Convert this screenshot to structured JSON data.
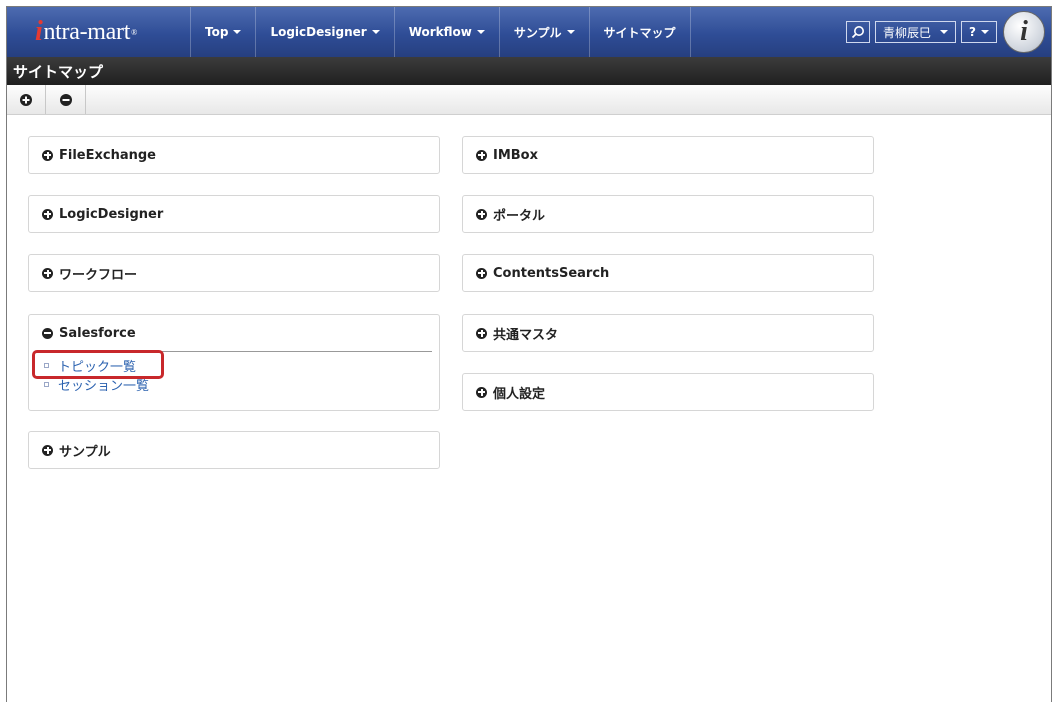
{
  "header": {
    "logo": {
      "mark": "i",
      "text": "ntra-mart",
      "reg": "®"
    },
    "nav": [
      {
        "label": "Top",
        "dropdown": true
      },
      {
        "label": "LogicDesigner",
        "dropdown": true
      },
      {
        "label": "Workflow",
        "dropdown": true
      },
      {
        "label": "サンプル",
        "dropdown": true
      },
      {
        "label": "サイトマップ",
        "dropdown": false
      }
    ],
    "user": {
      "name": "青柳辰巳"
    },
    "help_label": "?",
    "brand_glyph": "i"
  },
  "page": {
    "title": "サイトマップ"
  },
  "toolbar": {
    "expand_all_icon": "plus-circle-icon",
    "collapse_all_icon": "minus-circle-icon"
  },
  "sitemap": {
    "left": [
      {
        "label": "FileExchange",
        "expanded": false
      },
      {
        "label": "LogicDesigner",
        "expanded": false
      },
      {
        "label": "ワークフロー",
        "expanded": false
      },
      {
        "label": "Salesforce",
        "expanded": true,
        "items": [
          "トピック一覧",
          "セッション一覧"
        ]
      },
      {
        "label": "サンプル",
        "expanded": false
      }
    ],
    "right": [
      {
        "label": "IMBox",
        "expanded": false
      },
      {
        "label": "ポータル",
        "expanded": false
      },
      {
        "label": "ContentsSearch",
        "expanded": false
      },
      {
        "label": "共通マスタ",
        "expanded": false
      },
      {
        "label": "個人設定",
        "expanded": false
      }
    ]
  },
  "colors": {
    "nav_bg": "#2f4d96",
    "titlebar_bg": "#2a2a2a",
    "link": "#2d63b0",
    "highlight": "#c8282b"
  }
}
